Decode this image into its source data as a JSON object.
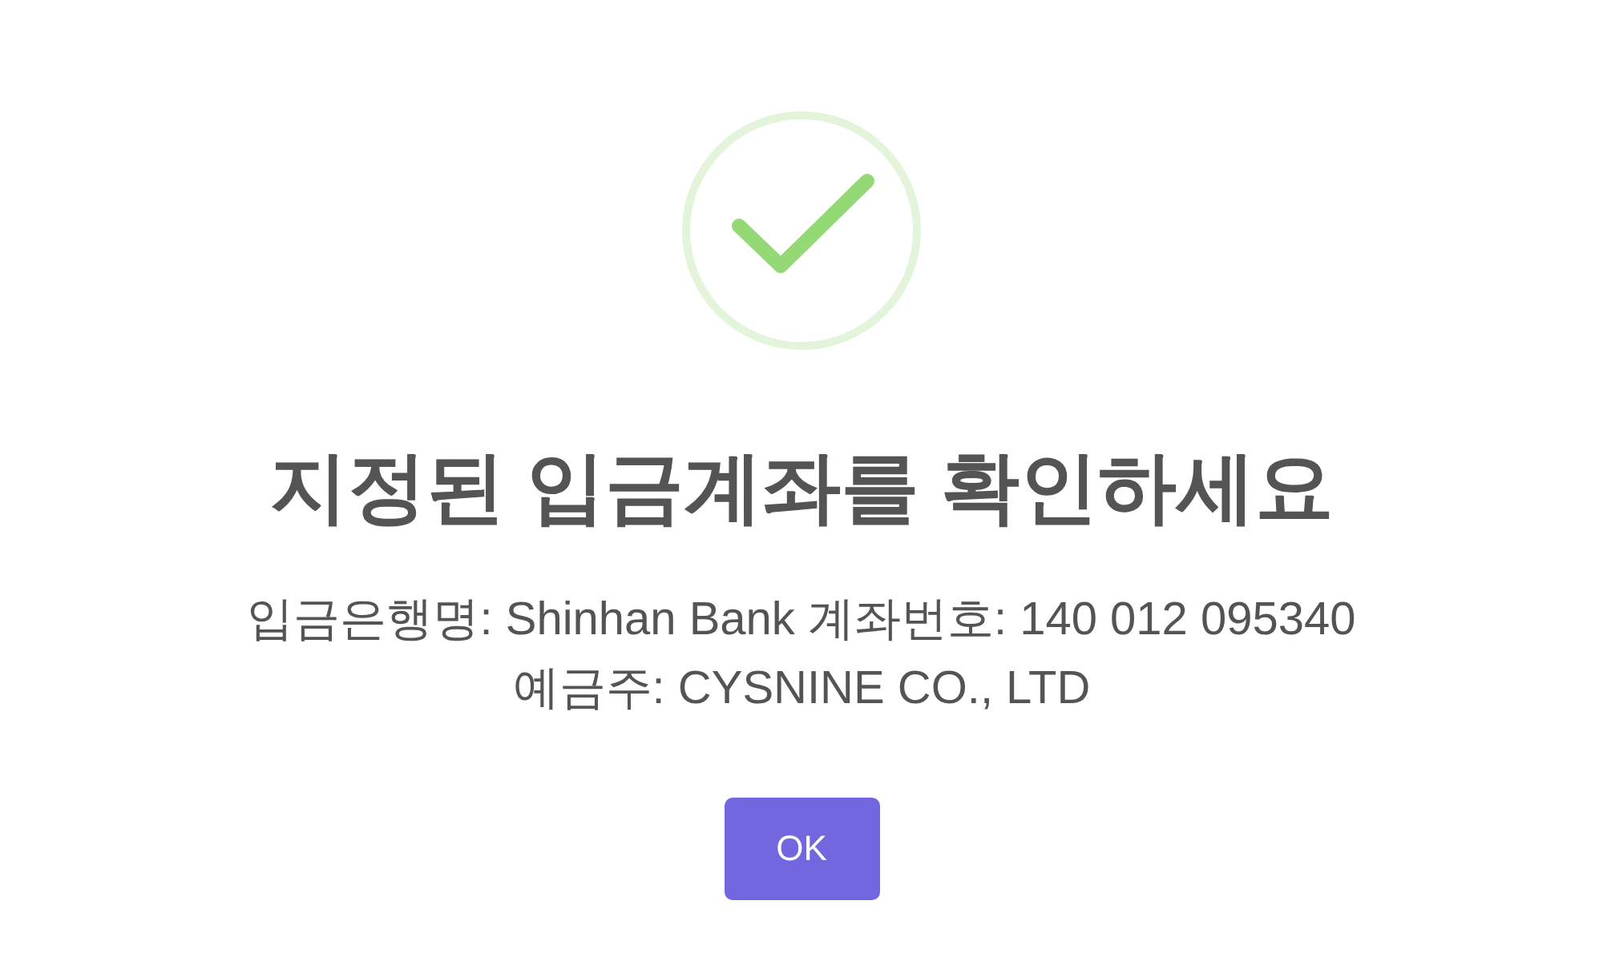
{
  "dialog": {
    "icon": {
      "kind": "success"
    },
    "title": "지정된 입금계좌를 확인하세요",
    "lines": [
      "입금은행명: Shinhan Bank 계좌번호: 140 012 095340",
      "예금주: CYSNINE CO., LTD"
    ],
    "buttons": [
      {
        "label": "OK"
      }
    ]
  }
}
